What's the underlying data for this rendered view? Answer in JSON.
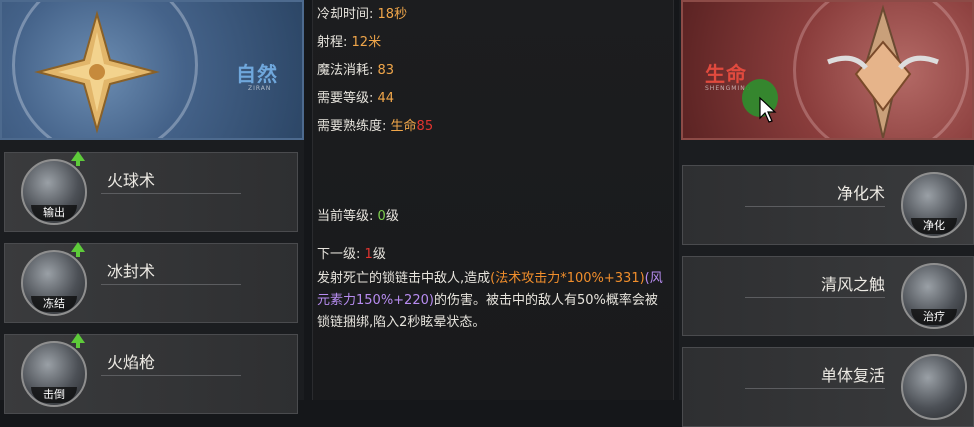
{
  "attributes": {
    "nature": {
      "title": "自然",
      "subtitle": "ZIRAN"
    },
    "life": {
      "title": "生命",
      "subtitle": "SHENGMING"
    }
  },
  "left_skills": [
    {
      "name": "火球术",
      "tag": "输出"
    },
    {
      "name": "冰封术",
      "tag": "冻结"
    },
    {
      "name": "火焰枪",
      "tag": "击倒"
    }
  ],
  "right_skills": [
    {
      "name": "净化术",
      "tag": "净化"
    },
    {
      "name": "清风之触",
      "tag": "治疗"
    },
    {
      "name": "单体复活",
      "tag": ""
    }
  ],
  "detail": {
    "cooldown_label": "冷却时间:",
    "cooldown_value": "18秒",
    "range_label": "射程:",
    "range_value": "12米",
    "mana_label": "魔法消耗:",
    "mana_value": "83",
    "level_req_label": "需要等级:",
    "level_req_value": "44",
    "prof_req_label": "需要熟练度:",
    "prof_req_school": "生命",
    "prof_req_value": "85",
    "current_level_label": "当前等级:",
    "current_level_value": "0",
    "current_level_unit": "级",
    "next_level_label": "下一级:",
    "next_level_value": "1",
    "next_level_unit": "级",
    "desc_1": "发射死亡的锁链击中敌人,造成",
    "desc_orange": "(法术攻击力*100%+331)",
    "desc_purple": "(风元素力150%+220)",
    "desc_2": "的伤害。被击中的敌人有50%概率会被锁链捆绑,陷入2秒眩晕状态。"
  },
  "colors": {
    "accent_orange": "#f0a64a",
    "accent_green": "#7fd04e",
    "accent_red": "#e0342f",
    "accent_purple": "#b78cf0",
    "nature_blue": "#6fa7dc",
    "life_red": "#e14a3e"
  }
}
